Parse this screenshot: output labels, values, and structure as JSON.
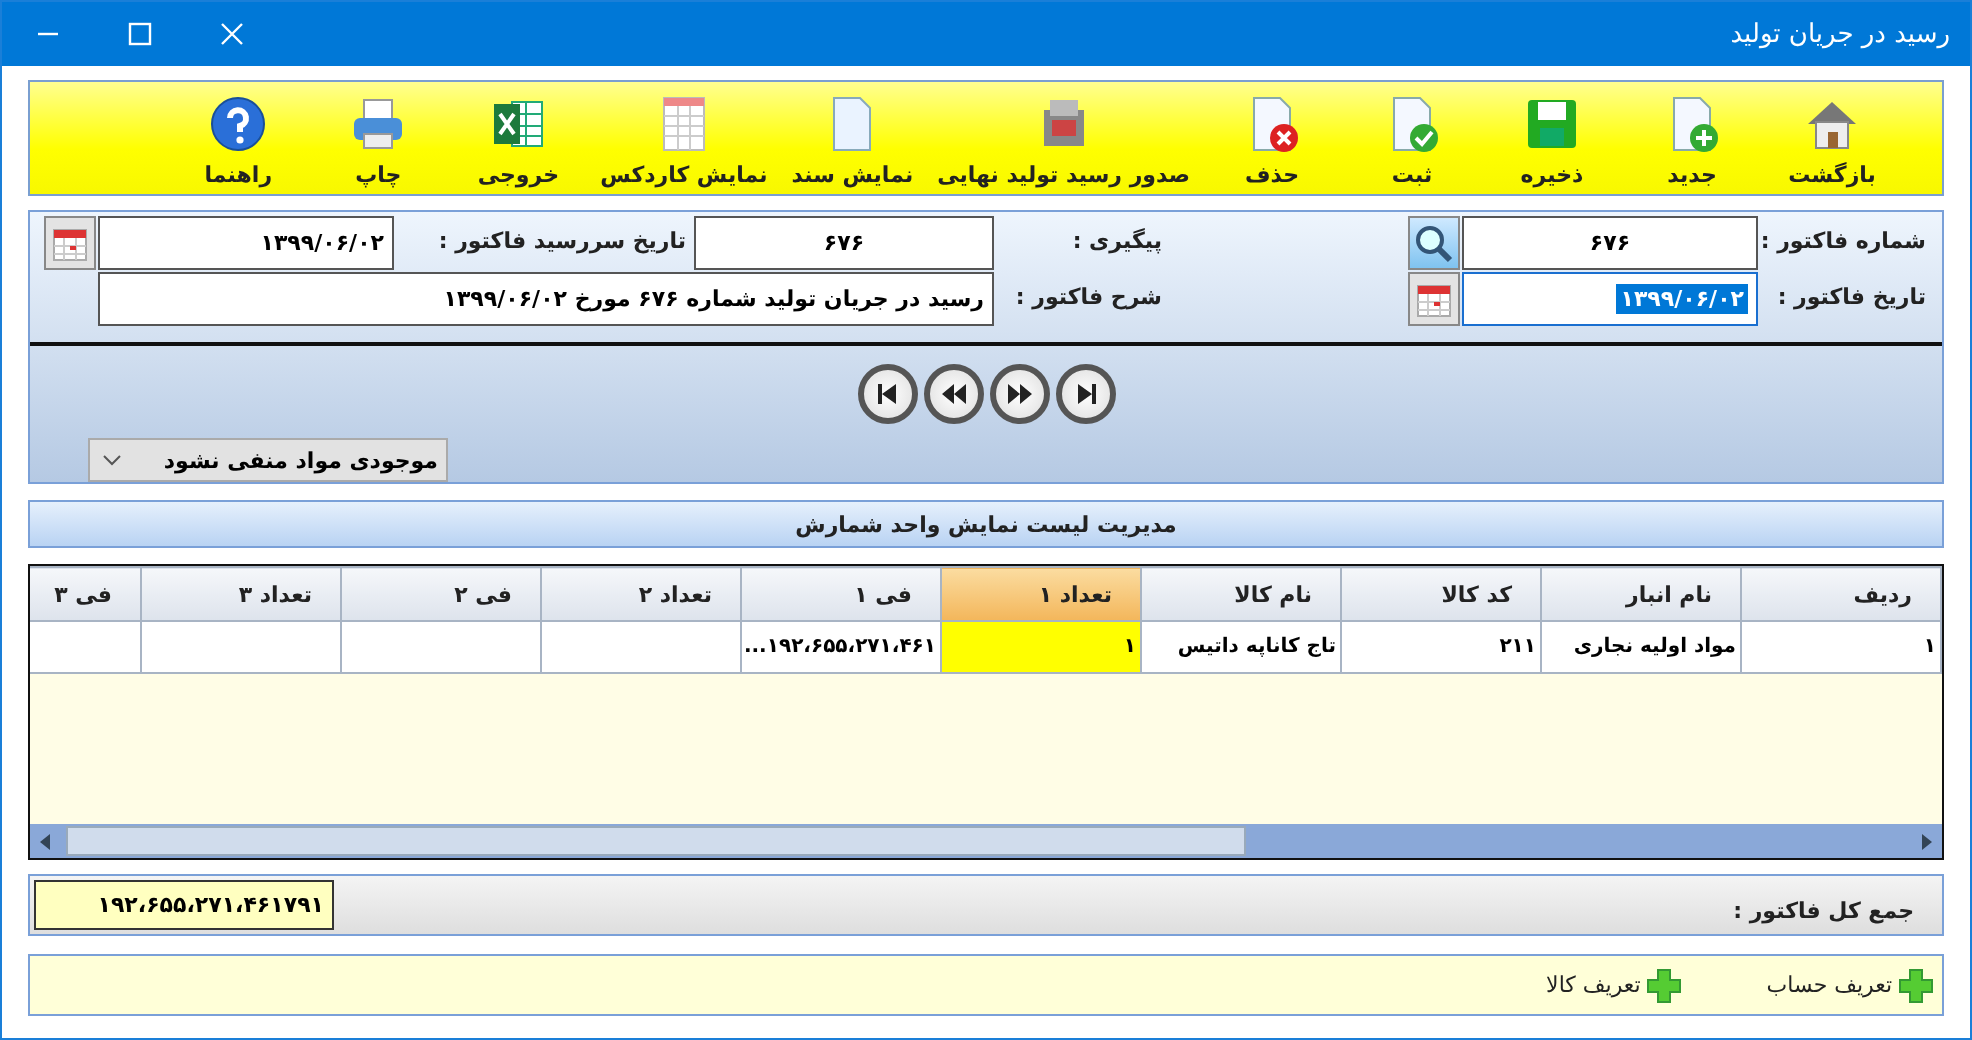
{
  "window": {
    "title": "رسید در جریان تولید"
  },
  "toolbar": [
    {
      "label": "بازگشت",
      "kind": "home"
    },
    {
      "label": "جدید",
      "kind": "new"
    },
    {
      "label": "ذخیره",
      "kind": "save"
    },
    {
      "label": "ثبت",
      "kind": "confirm"
    },
    {
      "label": "حذف",
      "kind": "delete"
    },
    {
      "label": "صدور رسید تولید نهایی",
      "kind": "machine"
    },
    {
      "label": "نمایش سند",
      "kind": "document"
    },
    {
      "label": "نمایش کاردکس",
      "kind": "sheet"
    },
    {
      "label": "خروجی",
      "kind": "excel"
    },
    {
      "label": "چاپ",
      "kind": "print"
    },
    {
      "label": "راهنما",
      "kind": "help"
    }
  ],
  "header": {
    "invoice_number": {
      "label": "شماره فاکتور :",
      "value": "۶۷۶"
    },
    "tracking": {
      "label": "پیگیری :",
      "value": "۶۷۶"
    },
    "due_date": {
      "label": "تاریخ سررسید فاکتور :",
      "value": "۱۳۹۹/۰۶/۰۲"
    },
    "invoice_date": {
      "label": "تاریخ فاکتور :",
      "value": "۱۳۹۹/۰۶/۰۲",
      "text_selected": true
    },
    "description": {
      "label": "شرح فاکتور :",
      "value": "رسید در جریان تولید شماره ۶۷۶ مورخ ۱۳۹۹/۰۶/۰۲"
    },
    "dropdown": {
      "value": "موجودی مواد منفی نشود"
    }
  },
  "list_bar": {
    "title": "مدیریت لیست نمایش واحد شمارش"
  },
  "table": {
    "columns": [
      {
        "label": "ردیف",
        "selected": false
      },
      {
        "label": "نام انبار",
        "selected": false
      },
      {
        "label": "کد کالا",
        "selected": false
      },
      {
        "label": "نام کالا",
        "selected": false
      },
      {
        "label": "تعداد ۱",
        "selected": true
      },
      {
        "label": "فی ۱",
        "selected": false
      },
      {
        "label": "تعداد ۲",
        "selected": false
      },
      {
        "label": "فی ۲",
        "selected": false
      },
      {
        "label": "تعداد ۳",
        "selected": false
      },
      {
        "label": "فی ۳",
        "selected": false
      }
    ],
    "rows": [
      {
        "cells": [
          "۱",
          "مواد اولیه نجاری",
          "۲۱۱",
          "تاج کاناپه داتیس",
          "۱",
          "۱۹۲،۶۵۵،۲۷۱،۴۶۱...",
          "",
          "",
          "",
          ""
        ]
      }
    ]
  },
  "total": {
    "label": "جمع کل فاکتور :",
    "value": "۱۹۲،۶۵۵،۲۷۱،۴۶۱۷۹۱"
  },
  "quick_links": [
    {
      "label": "تعریف حساب"
    },
    {
      "label": "تعریف کالا"
    }
  ]
}
